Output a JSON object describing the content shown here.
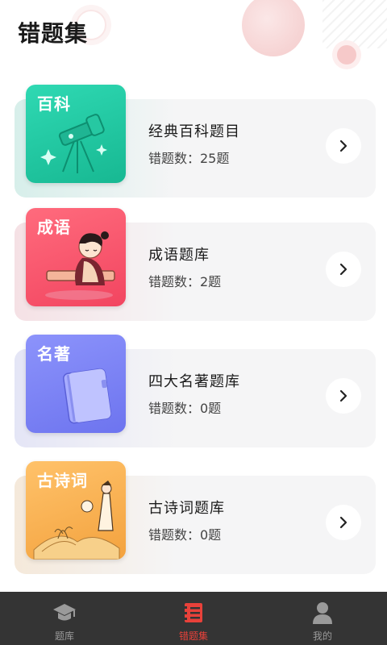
{
  "header": {
    "title": "错题集"
  },
  "cards": [
    {
      "tile_label": "百科",
      "title": "经典百科题目",
      "count": "错题数：25题",
      "color": "#21c8a4"
    },
    {
      "tile_label": "成语",
      "title": "成语题库",
      "count": "错题数：2题",
      "color": "#f5506a"
    },
    {
      "tile_label": "名著",
      "title": "四大名著题库",
      "count": "错题数：0题",
      "color": "#7f86f7"
    },
    {
      "tile_label": "古诗词",
      "title": "古诗词题库",
      "count": "错题数：0题",
      "color": "#f3a94a"
    }
  ],
  "tabbar": {
    "tabs": [
      {
        "label": "题库",
        "icon": "graduation-cap-icon"
      },
      {
        "label": "错题集",
        "icon": "notebook-list-icon",
        "active": true
      },
      {
        "label": "我的",
        "icon": "user-icon"
      }
    ],
    "active_color": "#e8413a",
    "inactive_color": "#9a9a9a"
  }
}
